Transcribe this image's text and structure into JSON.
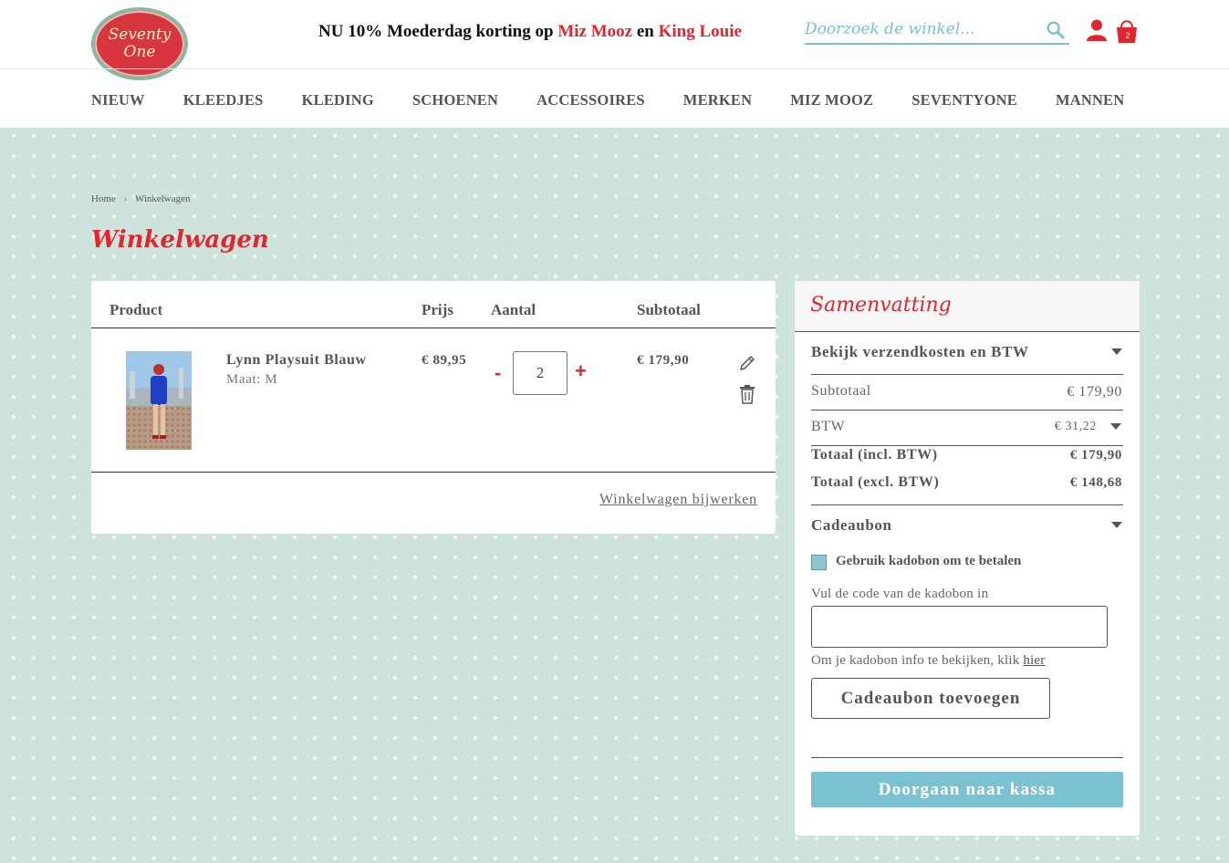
{
  "header": {
    "logo": {
      "line1": "Seventy",
      "line2": "One"
    },
    "promo": {
      "prefix": "NU 10% Moederdag korting op",
      "brand1": "Miz Mooz",
      "joiner": "en",
      "brand2": "King Louie"
    },
    "search": {
      "placeholder": "Doorzoek de winkel..."
    },
    "cart_count": "2"
  },
  "nav": [
    "NIEUW",
    "KLEEDJES",
    "KLEDING",
    "SCHOENEN",
    "ACCESSOIRES",
    "MERKEN",
    "MIZ MOOZ",
    "SEVENTYONE",
    "MANNEN"
  ],
  "breadcrumb": {
    "home": "Home",
    "current": "Winkelwagen"
  },
  "page_title": "Winkelwagen",
  "cart": {
    "headers": {
      "product": "Product",
      "price": "Prijs",
      "qty": "Aantal",
      "subtotal": "Subtotaal"
    },
    "item": {
      "name": "Lynn Playsuit Blauw",
      "size": "Maat: M",
      "price": "€ 89,95",
      "qty": "2",
      "subtotal": "€ 179,90"
    },
    "qty_minus": "-",
    "qty_plus": "+",
    "update_link": "Winkelwagen bijwerken"
  },
  "summary": {
    "title": "Samenvatting",
    "shipping_toggle": "Bekijk verzendkosten en BTW",
    "subtotal_label": "Subtotaal",
    "subtotal_value": "€ 179,90",
    "vat_label": "BTW",
    "vat_value": "€ 31,22",
    "total_incl_label": "Totaal (incl. BTW)",
    "total_incl_value": "€ 179,90",
    "total_excl_label": "Totaal (excl. BTW)",
    "total_excl_value": "€ 148,68",
    "giftcard_toggle": "Cadeaubon",
    "giftcard_checkbox_label": "Gebruik kadobon om te betalen",
    "giftcard_code_label": "Vul de code van de kadobon in",
    "giftcard_info_prefix": "Om je kadobon info te bekijken, klik",
    "giftcard_info_link": "hier",
    "add_giftcard_button": "Cadeaubon toevoegen",
    "checkout_button": "Doorgaan naar kassa"
  },
  "colors": {
    "accent_red": "#e0262e",
    "accent_blue": "#7ac2d1"
  }
}
